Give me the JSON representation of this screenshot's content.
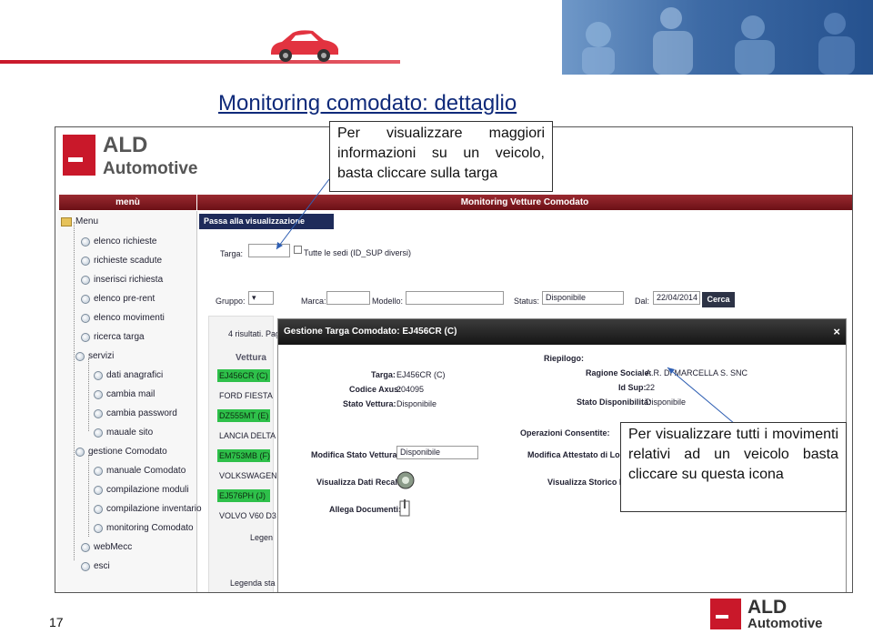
{
  "slide": {
    "title": "Monitoring comodato: dettaglio",
    "page_number": "17",
    "callout_top": "Per visualizzare maggiori informazioni su un veicolo, basta cliccare sulla targa",
    "callout_right": "Per visualizzare tutti i movimenti relativi ad un veicolo basta cliccare su questa icona"
  },
  "brand": {
    "name": "ALD",
    "sub": "Automotive",
    "colors": {
      "red": "#c9182a",
      "header": "#7a1a20",
      "nav": "#1e2b5a"
    }
  },
  "app": {
    "menu_header": "menù",
    "main_header": "Monitoring Vetture Comodato",
    "classic_button": "Passa alla visualizzazione classica",
    "menu_root": "Menu",
    "menu": [
      {
        "label": "elenco richieste",
        "icon": "globe-icon"
      },
      {
        "label": "richieste scadute",
        "icon": "globe-icon"
      },
      {
        "label": "inserisci richiesta",
        "icon": "globe-icon"
      },
      {
        "label": "elenco pre-rent",
        "icon": "globe-icon"
      },
      {
        "label": "elenco movimenti",
        "icon": "globe-icon"
      },
      {
        "label": "ricerca targa",
        "icon": "globe-icon"
      },
      {
        "label": "servizi",
        "icon": "globe-icon"
      },
      {
        "label": "dati anagrafici",
        "icon": "globe-icon"
      },
      {
        "label": "cambia mail",
        "icon": "globe-icon"
      },
      {
        "label": "cambia password",
        "icon": "globe-icon"
      },
      {
        "label": "mauale sito",
        "icon": "globe-icon"
      },
      {
        "label": "gestione Comodato",
        "icon": "globe-icon"
      },
      {
        "label": "manuale Comodato",
        "icon": "globe-icon"
      },
      {
        "label": "compilazione moduli",
        "icon": "globe-icon"
      },
      {
        "label": "compilazione inventario",
        "icon": "globe-icon"
      },
      {
        "label": "monitoring Comodato",
        "icon": "globe-icon"
      },
      {
        "label": "webMecc",
        "icon": "globe-icon"
      },
      {
        "label": "esci",
        "icon": "globe-icon"
      }
    ],
    "filters": {
      "targa_label": "Targa:",
      "sedi_label": "Tutte le sedi (ID_SUP diversi)",
      "gruppo_label": "Gruppo:",
      "marca_label": "Marca:",
      "modello_label": "Modello:",
      "status_label": "Status:",
      "status_value": "Disponibile",
      "dal_label": "Dal:",
      "dal_value": "22/04/2014",
      "search_button": "Cerca"
    },
    "results": {
      "count_text": "4 risultati. Pag",
      "column": "Vettura",
      "plates": [
        {
          "text": "EJ456CR (C)",
          "highlight": true
        },
        {
          "text": "FORD FIESTA",
          "highlight": false
        },
        {
          "text": "DZ555MT (E)",
          "highlight": true
        },
        {
          "text": "LANCIA DELTA",
          "highlight": false
        },
        {
          "text": "EM753MB (F)",
          "highlight": true
        },
        {
          "text": "VOLKSWAGEN",
          "highlight": false
        },
        {
          "text": "EJ576PH (J)",
          "highlight": true
        },
        {
          "text": "VOLVO V60 D3",
          "highlight": false
        }
      ],
      "legend1": "Legen",
      "legend2": "Legenda sta"
    },
    "modal": {
      "title": "Gestione Targa Comodato: EJ456CR (C)",
      "close": "×",
      "targa_label": "Targa:",
      "targa_value": "EJ456CR (C)",
      "axus_label": "Codice Axus:",
      "axus_value": "204095",
      "stato_label": "Stato Vettura:",
      "stato_value": "Disponibile",
      "riepilogo": "Riepilogo:",
      "ragione_label": "Ragione Sociale:",
      "ragione_value": "A.R. DI MARCELLA S. SNC",
      "idsup_label": "Id Sup:",
      "idsup_value": "22",
      "stato_disp_label": "Stato Disponibilità:",
      "stato_disp_value": "Disponibile",
      "operazioni": "Operazioni Consentite:",
      "modifica_stato_label": "Modifica Stato Vettura:",
      "modifica_stato_value": "Disponibile",
      "modifica_attestato": "Modifica Attestato di Loca",
      "visualizza_recall": "Visualizza Dati Recall:",
      "visualizza_storico": "Visualizza Storico De",
      "allega": "Allega Documenti:"
    }
  }
}
